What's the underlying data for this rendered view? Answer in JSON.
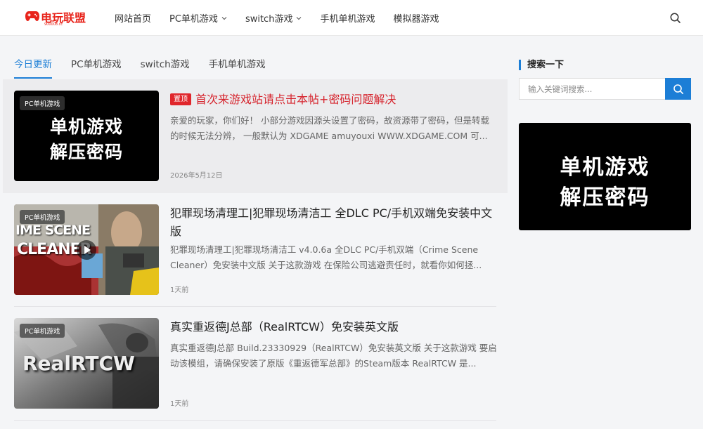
{
  "brand": {
    "name": "电玩联盟",
    "sub": "900008.cc",
    "color": "#e8231a"
  },
  "nav": {
    "items": [
      {
        "label": "网站首页"
      },
      {
        "label": "PC单机游戏"
      },
      {
        "label": "switch游戏"
      },
      {
        "label": "手机单机游戏"
      },
      {
        "label": "模拟器游戏"
      }
    ]
  },
  "tabs": [
    {
      "label": "今日更新",
      "active": true
    },
    {
      "label": "PC单机游戏"
    },
    {
      "label": "switch游戏"
    },
    {
      "label": "手机单机游戏"
    }
  ],
  "posts": [
    {
      "tag": "PC单机游戏",
      "sticky_badge": "置顶",
      "title": "首次来游戏站请点击本帖+密码问题解决",
      "excerpt": "亲爱的玩家，你们好！ 小部分游戏因源头设置了密码，故资源带了密码，但是转载的时候无法分辨， 一般默认为 XDGAME amuyouxi WWW.XDGAME.COM 可...",
      "date": "2026年5月12日",
      "thumb_line1": "单机游戏",
      "thumb_line2": "解压密码"
    },
    {
      "tag": "PC单机游戏",
      "title": "犯罪现场清理工|犯罪现场清洁工 全DLC PC/手机双端免安装中文版",
      "excerpt": "犯罪现场清理工|犯罪现场清洁工 v4.0.6a 全DLC PC/手机双端（Crime Scene Cleaner）免安装中文版 关于这款游戏 在保险公司逃避责任时，就看你如何拯...",
      "date": "1天前",
      "thumb_text1": "IME SCENE",
      "thumb_text2": "CLEANER"
    },
    {
      "tag": "PC单机游戏",
      "title": "真实重返德J总部（RealRTCW）免安装英文版",
      "excerpt": "真实重返德J总部 Build.23330929（RealRTCW）免安装英文版 关于这款游戏 要启动该模组，请确保安装了原版《重返德军总部》的Steam版本 RealRTCW 是...",
      "date": "1天前",
      "thumb_text1": "RealRTCW"
    }
  ],
  "sidebar": {
    "search_title": "搜索一下",
    "search_placeholder": "输入关键词搜索...",
    "banner_line1": "单机游戏",
    "banner_line2": "解压密码"
  },
  "colors": {
    "accent": "#1c7ed6",
    "sticky_red": "#e0262b"
  }
}
